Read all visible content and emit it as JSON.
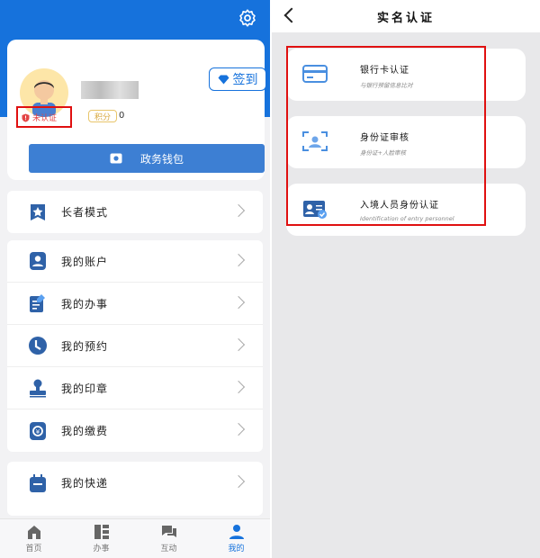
{
  "left": {
    "profile": {
      "sign_in_label": "签到",
      "status_label": "未认证",
      "points_label": "积分",
      "points_value": "0",
      "wallet_label": "政务钱包"
    },
    "menu_groups": [
      {
        "items": [
          {
            "label": "长者模式",
            "icon": "star-badge-icon"
          }
        ]
      },
      {
        "items": [
          {
            "label": "我的账户",
            "icon": "account-icon"
          },
          {
            "label": "我的办事",
            "icon": "document-edit-icon"
          },
          {
            "label": "我的预约",
            "icon": "clock-icon"
          },
          {
            "label": "我的印章",
            "icon": "stamp-icon"
          },
          {
            "label": "我的缴费",
            "icon": "payment-icon"
          }
        ]
      },
      {
        "items": [
          {
            "label": "我的快递",
            "icon": "package-icon"
          }
        ]
      }
    ],
    "tabbar": [
      {
        "label": "首页",
        "icon": "home-icon",
        "active": false
      },
      {
        "label": "办事",
        "icon": "grid-icon",
        "active": false
      },
      {
        "label": "互动",
        "icon": "chat-icon",
        "active": false
      },
      {
        "label": "我的",
        "icon": "person-icon",
        "active": true
      }
    ]
  },
  "right": {
    "title": "实名认证",
    "options": [
      {
        "title": "银行卡认证",
        "subtitle": "与银行预留信息比对",
        "icon": "bank-card-icon"
      },
      {
        "title": "身份证审核",
        "subtitle": "身份证+人脸审核",
        "icon": "face-id-icon"
      },
      {
        "title": "入境人员身份认证",
        "subtitle": "Identification of entry personnel",
        "icon": "id-card-icon"
      }
    ]
  },
  "colors": {
    "brand_blue": "#1672dc",
    "highlight_red": "#e01010"
  }
}
